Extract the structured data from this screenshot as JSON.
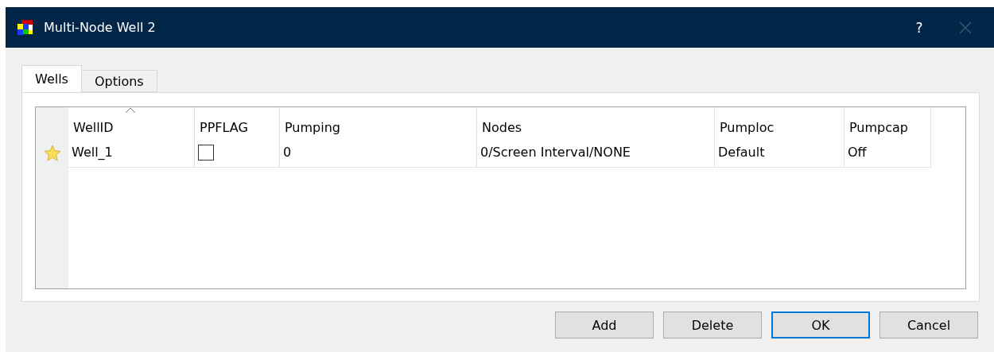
{
  "window": {
    "title": "Multi-Node Well 2",
    "help": "?"
  },
  "tabs": [
    {
      "label": "Wells",
      "selected": true
    },
    {
      "label": "Options",
      "selected": false
    }
  ],
  "table": {
    "columns": [
      {
        "label": "WellID",
        "sorted": true
      },
      {
        "label": "PPFLAG",
        "sorted": false
      },
      {
        "label": "Pumping",
        "sorted": false
      },
      {
        "label": "Nodes",
        "sorted": false
      },
      {
        "label": "Pumploc",
        "sorted": false
      },
      {
        "label": "Pumpcap",
        "sorted": false
      }
    ],
    "rows": [
      {
        "cells": [
          {
            "kind": "text",
            "text": "Well_1"
          },
          {
            "kind": "checkbox",
            "checked": false
          },
          {
            "kind": "text",
            "text": "0"
          },
          {
            "kind": "text",
            "text": "0/Screen Interval/NONE"
          },
          {
            "kind": "text",
            "text": "Default"
          },
          {
            "kind": "text",
            "text": "Off"
          }
        ]
      }
    ]
  },
  "buttons": [
    {
      "label": "Add",
      "default": false
    },
    {
      "label": "Delete",
      "default": false
    },
    {
      "label": "OK",
      "default": true
    },
    {
      "label": "Cancel",
      "default": false
    }
  ]
}
